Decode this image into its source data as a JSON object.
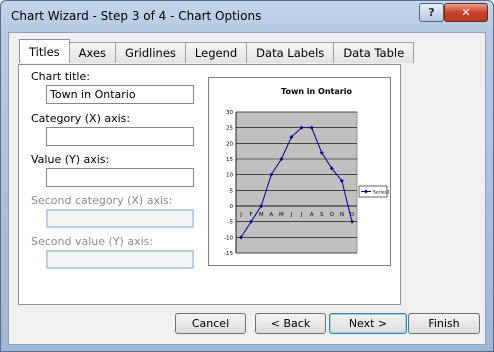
{
  "window": {
    "title": "Chart Wizard - Step 3 of 4 - Chart Options",
    "help_label": "?",
    "close_label": "✕"
  },
  "tabs": [
    {
      "label": "Titles",
      "active": true
    },
    {
      "label": "Axes"
    },
    {
      "label": "Gridlines"
    },
    {
      "label": "Legend"
    },
    {
      "label": "Data Labels"
    },
    {
      "label": "Data Table"
    }
  ],
  "fields": {
    "chart_title": {
      "label": "Chart title:",
      "value": "Town in Ontario"
    },
    "category_x": {
      "label": "Category (X) axis:",
      "value": ""
    },
    "value_y": {
      "label": "Value (Y) axis:",
      "value": ""
    },
    "second_category_x": {
      "label": "Second category (X) axis:",
      "value": ""
    },
    "second_value_y": {
      "label": "Second value (Y) axis:",
      "value": ""
    }
  },
  "buttons": {
    "cancel": "Cancel",
    "back": "< Back",
    "next": "Next >",
    "finish": "Finish"
  },
  "chart_data": {
    "type": "line",
    "title": "Town in Ontario",
    "categories": [
      "J",
      "F",
      "M",
      "A",
      "M",
      "J",
      "J",
      "A",
      "S",
      "O",
      "N",
      "D"
    ],
    "series": [
      {
        "name": "Series1",
        "values": [
          -10,
          -5,
          0,
          10,
          15,
          22,
          25,
          25,
          17,
          12,
          8,
          -5
        ]
      }
    ],
    "ylim": [
      -15,
      30
    ],
    "yticks": [
      30,
      25,
      20,
      15,
      10,
      5,
      0,
      -5,
      -10,
      -15
    ],
    "grid": true,
    "legend": "right",
    "plot_background": "#c0c0c0",
    "series_color": "#000080"
  }
}
